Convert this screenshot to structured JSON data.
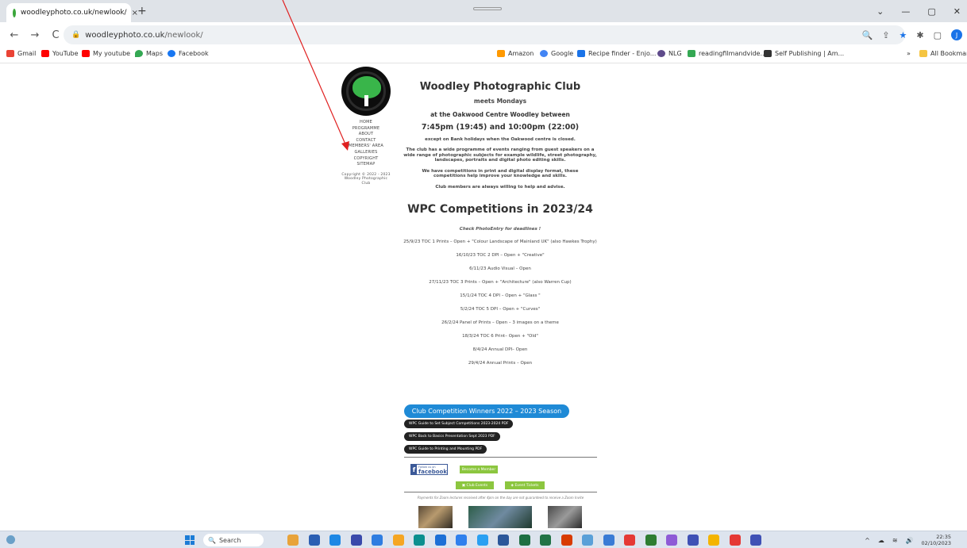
{
  "browser": {
    "tab_title": "woodleyphoto.co.uk/newlook/",
    "tab_close": "×",
    "new_tab": "+",
    "window_controls": [
      "⌄",
      "—",
      "▢",
      "✕"
    ],
    "url_domain": "woodleyphoto.co.uk",
    "url_path": "/newlook/",
    "nav_back": "←",
    "nav_forward": "→",
    "nav_reload": "C",
    "right_icons": [
      "🔍",
      "⇪",
      "★",
      "✱",
      "▢"
    ],
    "avatar_letter": "J",
    "bookmarks_left": [
      {
        "label": "Gmail",
        "color": "#ea4335"
      },
      {
        "label": "YouTube",
        "color": "#ff0000"
      },
      {
        "label": "My youtube",
        "color": "#ff0000"
      },
      {
        "label": "Maps",
        "color": "#34a853"
      },
      {
        "label": "Facebook",
        "color": "#1877f2"
      }
    ],
    "bookmarks_right": [
      {
        "label": "Amazon",
        "color": "#ff9900"
      },
      {
        "label": "Google",
        "color": "#4285f4"
      },
      {
        "label": "Recipe finder - Enjo...",
        "color": "#1a73e8"
      },
      {
        "label": "NLG",
        "color": "#5f4b8b"
      },
      {
        "label": "readingfilmandvide...",
        "color": "#34a853"
      },
      {
        "label": "Self Publishing | Am...",
        "color": "#333333"
      }
    ],
    "more_bookmarks": "»",
    "all_bookmarks": "All Bookmarks"
  },
  "site": {
    "nav": [
      "HOME",
      "PROGRAMME",
      "ABOUT",
      "CONTACT",
      "MEMBERS' AREA",
      "GALLERIES",
      "COPYRIGHT",
      "SITEMAP"
    ],
    "copyright": "Copyright © 2022 - 2023 Woodley Photographic Club",
    "title": "Woodley Photographic Club",
    "meets": "meets Mondays",
    "location": "at the Oakwood Centre Woodley between",
    "time": "7:45pm (19:45) and 10:00pm (22:00)",
    "except": "except on Bank holidays when the Oakwood centre is closed.",
    "para1": "The club has a wide programme of events ranging from guest speakers on a wide range of photographic subjects for example wildlife, street photography, landscapes, portraits and digital photo editing skills.",
    "para2": "We have competitions in print and digital display format, these competitions help improve your knowledge and skills.",
    "para3": "Club members are always willing to help and advise.",
    "comp_heading": "WPC Competitions in 2023/24",
    "check": "Check PhotoEntry for deadlines !",
    "competitions": [
      "25/9/23 TOC 1 Prints – Open + \"Colour Landscape of Mainland UK\" (also Hawkes Trophy)",
      "16/10/23 TOC 2 DPI – Open + \"Creative\"",
      "6/11/23 Audio Visual – Open",
      "27/11/23 TOC 3 Prints – Open + \"Architecture\" (also Warren Cup)",
      "15/1/24 TOC 4 DPI – Open + \"Glass \"",
      "5/2/24 TOC 5 DPI – Open + \"Curves\"",
      "26/2/24 Panel of Prints – Open – 3 images on a theme",
      "18/3/24 TOC 6 Print– Open + \"Old\"",
      "8/4/24 Annual DPI– Open",
      "29/4/24 Annual Prints – Open"
    ],
    "winners_button": "Club Competition Winners 2022 – 2023 Season",
    "pdf_buttons": [
      "WPC Guide to Set Subject Competitions 2023-2024 PDF",
      "WPC Back to Basics Presentation Sept 2023 PDF",
      "WPC Guide to Printing and Mounting PDF"
    ],
    "facebook_small": "Follow us on",
    "facebook": "facebook",
    "become_member": "Become a Member",
    "club_events": "Club Events",
    "event_tickets": "Event Tickets",
    "payments_note": "Payments for Zoom lectures received after 4pm on the day are not guaranteed to receive a Zoom Invite"
  },
  "taskbar": {
    "search": "Search",
    "time": "22:35",
    "date": "02/10/2023",
    "icon_colors": [
      "#e8a33a",
      "#2b5fb3",
      "#1e88e5",
      "#3949ab",
      "#2e7de1",
      "#f5a623",
      "#0b8f8f",
      "#1c6fd6",
      "#2f80ed",
      "#2aa0f2",
      "#2b579a",
      "#1d6f42",
      "#217346",
      "#d83b01",
      "#5aa0d8",
      "#3a7bd5",
      "#e53935",
      "#2e7d32",
      "#8e5bd6",
      "#3f51b5",
      "#f4b400",
      "#e53935",
      "#3f51b5"
    ]
  }
}
